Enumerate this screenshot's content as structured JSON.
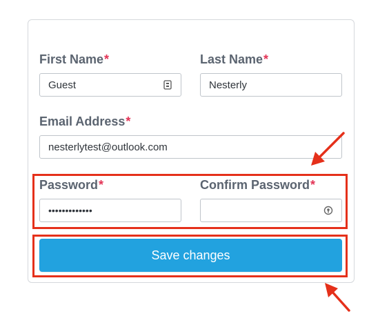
{
  "form": {
    "first_name": {
      "label": "First Name",
      "required_mark": "*",
      "value": "Guest"
    },
    "last_name": {
      "label": "Last Name",
      "required_mark": "*",
      "value": "Nesterly"
    },
    "email": {
      "label": "Email Address",
      "required_mark": "*",
      "value": "nesterlytest@outlook.com"
    },
    "password": {
      "label": "Password",
      "required_mark": "*",
      "value": "•••••••••••••"
    },
    "confirm_password": {
      "label": "Confirm Password",
      "required_mark": "*",
      "value": ""
    },
    "save_label": "Save changes"
  },
  "icons": {
    "first_name_field_icon": "contact-card-icon",
    "confirm_password_field_icon": "password-manager-icon",
    "annotation_arrows": "arrow-icon"
  },
  "colors": {
    "label": "#5b6470",
    "required": "#e33456",
    "button": "#22a2df",
    "annotation": "#e5301a"
  }
}
